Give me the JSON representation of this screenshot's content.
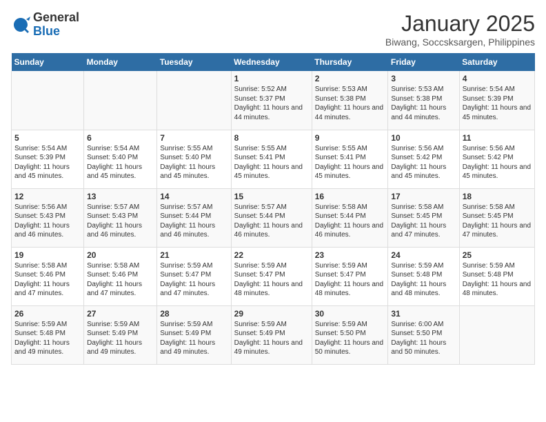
{
  "logo": {
    "general": "General",
    "blue": "Blue"
  },
  "title": "January 2025",
  "subtitle": "Biwang, Soccsksargen, Philippines",
  "days_of_week": [
    "Sunday",
    "Monday",
    "Tuesday",
    "Wednesday",
    "Thursday",
    "Friday",
    "Saturday"
  ],
  "weeks": [
    [
      {
        "day": "",
        "content": ""
      },
      {
        "day": "",
        "content": ""
      },
      {
        "day": "",
        "content": ""
      },
      {
        "day": "1",
        "content": "Sunrise: 5:52 AM\nSunset: 5:37 PM\nDaylight: 11 hours and 44 minutes."
      },
      {
        "day": "2",
        "content": "Sunrise: 5:53 AM\nSunset: 5:38 PM\nDaylight: 11 hours and 44 minutes."
      },
      {
        "day": "3",
        "content": "Sunrise: 5:53 AM\nSunset: 5:38 PM\nDaylight: 11 hours and 44 minutes."
      },
      {
        "day": "4",
        "content": "Sunrise: 5:54 AM\nSunset: 5:39 PM\nDaylight: 11 hours and 45 minutes."
      }
    ],
    [
      {
        "day": "5",
        "content": "Sunrise: 5:54 AM\nSunset: 5:39 PM\nDaylight: 11 hours and 45 minutes."
      },
      {
        "day": "6",
        "content": "Sunrise: 5:54 AM\nSunset: 5:40 PM\nDaylight: 11 hours and 45 minutes."
      },
      {
        "day": "7",
        "content": "Sunrise: 5:55 AM\nSunset: 5:40 PM\nDaylight: 11 hours and 45 minutes."
      },
      {
        "day": "8",
        "content": "Sunrise: 5:55 AM\nSunset: 5:41 PM\nDaylight: 11 hours and 45 minutes."
      },
      {
        "day": "9",
        "content": "Sunrise: 5:55 AM\nSunset: 5:41 PM\nDaylight: 11 hours and 45 minutes."
      },
      {
        "day": "10",
        "content": "Sunrise: 5:56 AM\nSunset: 5:42 PM\nDaylight: 11 hours and 45 minutes."
      },
      {
        "day": "11",
        "content": "Sunrise: 5:56 AM\nSunset: 5:42 PM\nDaylight: 11 hours and 45 minutes."
      }
    ],
    [
      {
        "day": "12",
        "content": "Sunrise: 5:56 AM\nSunset: 5:43 PM\nDaylight: 11 hours and 46 minutes."
      },
      {
        "day": "13",
        "content": "Sunrise: 5:57 AM\nSunset: 5:43 PM\nDaylight: 11 hours and 46 minutes."
      },
      {
        "day": "14",
        "content": "Sunrise: 5:57 AM\nSunset: 5:44 PM\nDaylight: 11 hours and 46 minutes."
      },
      {
        "day": "15",
        "content": "Sunrise: 5:57 AM\nSunset: 5:44 PM\nDaylight: 11 hours and 46 minutes."
      },
      {
        "day": "16",
        "content": "Sunrise: 5:58 AM\nSunset: 5:44 PM\nDaylight: 11 hours and 46 minutes."
      },
      {
        "day": "17",
        "content": "Sunrise: 5:58 AM\nSunset: 5:45 PM\nDaylight: 11 hours and 47 minutes."
      },
      {
        "day": "18",
        "content": "Sunrise: 5:58 AM\nSunset: 5:45 PM\nDaylight: 11 hours and 47 minutes."
      }
    ],
    [
      {
        "day": "19",
        "content": "Sunrise: 5:58 AM\nSunset: 5:46 PM\nDaylight: 11 hours and 47 minutes."
      },
      {
        "day": "20",
        "content": "Sunrise: 5:58 AM\nSunset: 5:46 PM\nDaylight: 11 hours and 47 minutes."
      },
      {
        "day": "21",
        "content": "Sunrise: 5:59 AM\nSunset: 5:47 PM\nDaylight: 11 hours and 47 minutes."
      },
      {
        "day": "22",
        "content": "Sunrise: 5:59 AM\nSunset: 5:47 PM\nDaylight: 11 hours and 48 minutes."
      },
      {
        "day": "23",
        "content": "Sunrise: 5:59 AM\nSunset: 5:47 PM\nDaylight: 11 hours and 48 minutes."
      },
      {
        "day": "24",
        "content": "Sunrise: 5:59 AM\nSunset: 5:48 PM\nDaylight: 11 hours and 48 minutes."
      },
      {
        "day": "25",
        "content": "Sunrise: 5:59 AM\nSunset: 5:48 PM\nDaylight: 11 hours and 48 minutes."
      }
    ],
    [
      {
        "day": "26",
        "content": "Sunrise: 5:59 AM\nSunset: 5:48 PM\nDaylight: 11 hours and 49 minutes."
      },
      {
        "day": "27",
        "content": "Sunrise: 5:59 AM\nSunset: 5:49 PM\nDaylight: 11 hours and 49 minutes."
      },
      {
        "day": "28",
        "content": "Sunrise: 5:59 AM\nSunset: 5:49 PM\nDaylight: 11 hours and 49 minutes."
      },
      {
        "day": "29",
        "content": "Sunrise: 5:59 AM\nSunset: 5:49 PM\nDaylight: 11 hours and 49 minutes."
      },
      {
        "day": "30",
        "content": "Sunrise: 5:59 AM\nSunset: 5:50 PM\nDaylight: 11 hours and 50 minutes."
      },
      {
        "day": "31",
        "content": "Sunrise: 6:00 AM\nSunset: 5:50 PM\nDaylight: 11 hours and 50 minutes."
      },
      {
        "day": "",
        "content": ""
      }
    ]
  ]
}
